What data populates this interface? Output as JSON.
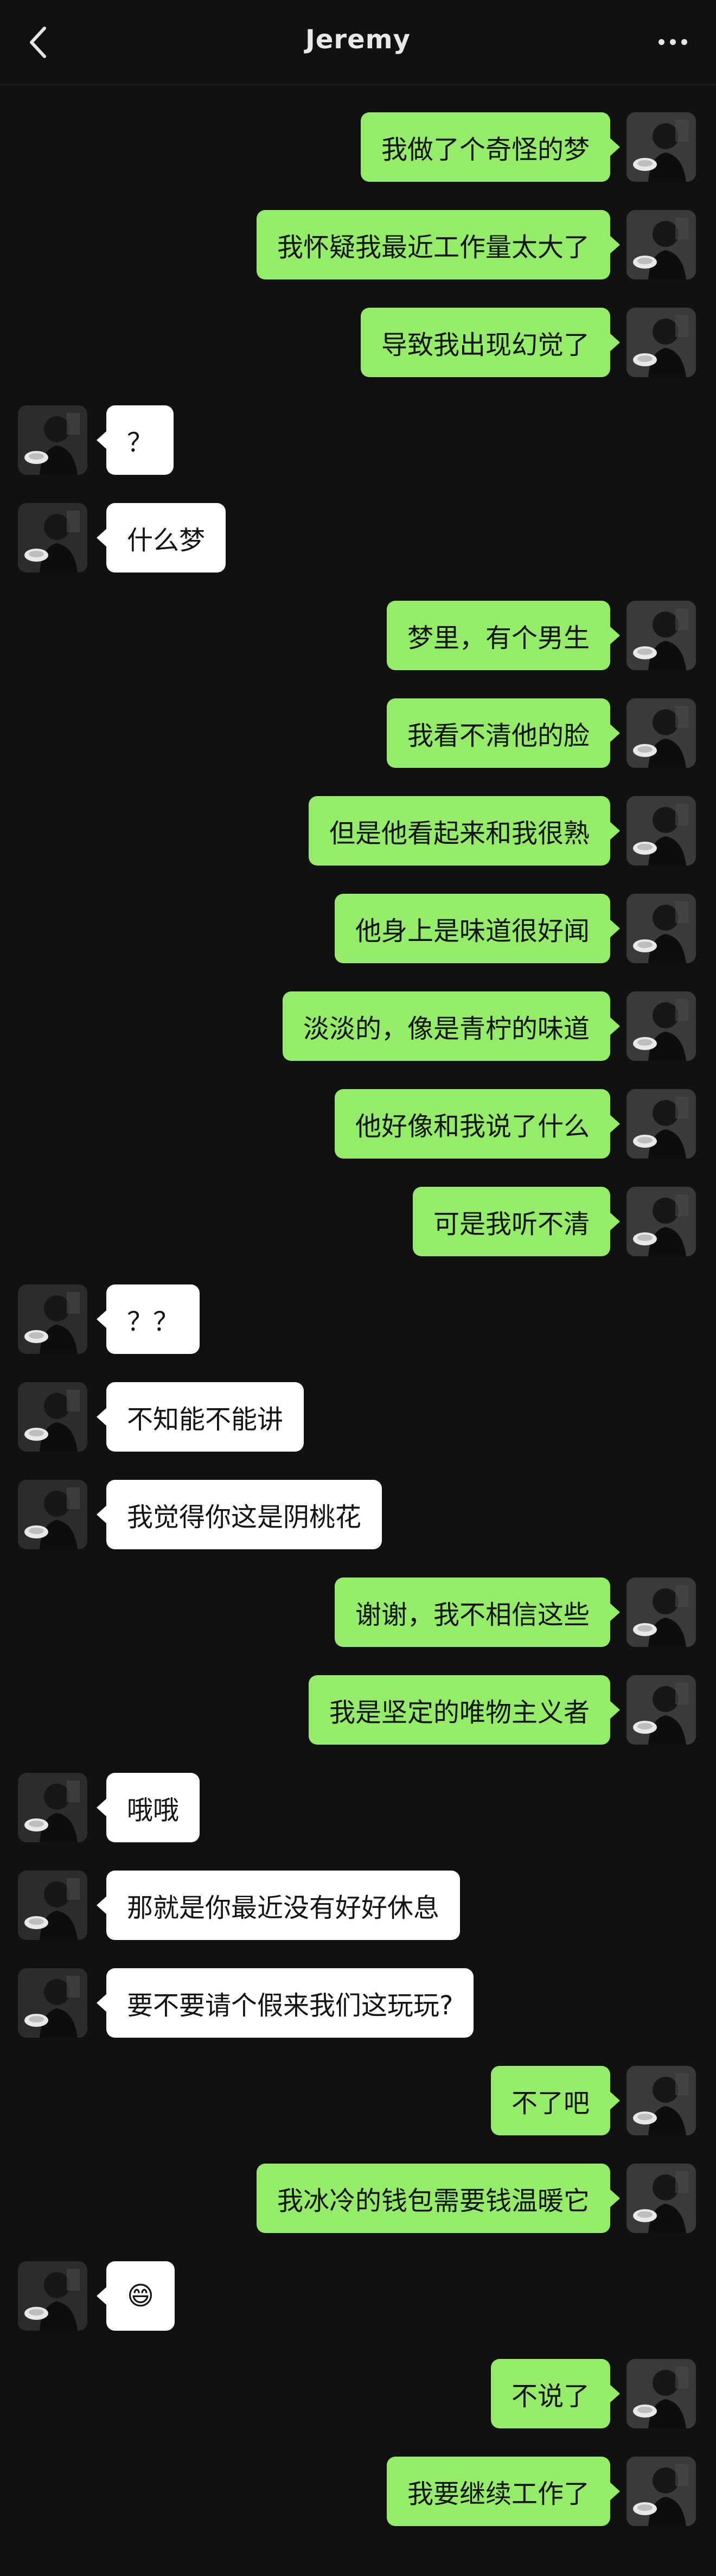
{
  "header": {
    "title": "Jeremy"
  },
  "colors": {
    "background": "#111111",
    "sent_bubble": "#95ec69",
    "received_bubble": "#ffffff"
  },
  "messages": [
    {
      "side": "right",
      "text": "我做了个奇怪的梦"
    },
    {
      "side": "right",
      "text": "我怀疑我最近工作量太大了"
    },
    {
      "side": "right",
      "text": "导致我出现幻觉了"
    },
    {
      "side": "left",
      "text": "？"
    },
    {
      "side": "left",
      "text": "什么梦"
    },
    {
      "side": "right",
      "text": "梦里，有个男生"
    },
    {
      "side": "right",
      "text": "我看不清他的脸"
    },
    {
      "side": "right",
      "text": "但是他看起来和我很熟"
    },
    {
      "side": "right",
      "text": "他身上是味道很好闻"
    },
    {
      "side": "right",
      "text": "淡淡的，像是青柠的味道"
    },
    {
      "side": "right",
      "text": "他好像和我说了什么"
    },
    {
      "side": "right",
      "text": "可是我听不清"
    },
    {
      "side": "left",
      "text": "？？"
    },
    {
      "side": "left",
      "text": "不知能不能讲"
    },
    {
      "side": "left",
      "text": "我觉得你这是阴桃花"
    },
    {
      "side": "right",
      "text": "谢谢，我不相信这些"
    },
    {
      "side": "right",
      "text": "我是坚定的唯物主义者"
    },
    {
      "side": "left",
      "text": "哦哦"
    },
    {
      "side": "left",
      "text": "那就是你最近没有好好休息"
    },
    {
      "side": "left",
      "text": "要不要请个假来我们这玩玩?"
    },
    {
      "side": "right",
      "text": "不了吧"
    },
    {
      "side": "right",
      "text": "我冰冷的钱包需要钱温暖它"
    },
    {
      "side": "left",
      "text": "😄"
    },
    {
      "side": "right",
      "text": "不说了"
    },
    {
      "side": "right",
      "text": "我要继续工作了"
    }
  ]
}
